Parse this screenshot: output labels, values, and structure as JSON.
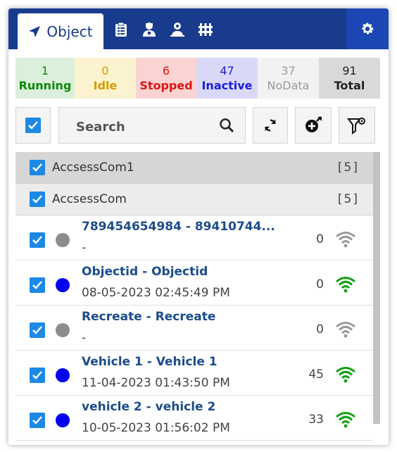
{
  "tabs": {
    "object_label": "Object",
    "icons": [
      "clipboard-list-icon",
      "driver-person-icon",
      "location-person-icon",
      "fence-icon"
    ]
  },
  "status": [
    {
      "count": "1",
      "label": "Running",
      "bg": "#dcefdc",
      "color": "#0a8a0a"
    },
    {
      "count": "0",
      "label": "Idle",
      "bg": "#fbf3cf",
      "color": "#d99a00"
    },
    {
      "count": "6",
      "label": "Stopped",
      "bg": "#fbd3d3",
      "color": "#e01414"
    },
    {
      "count": "47",
      "label": "Inactive",
      "bg": "#d9d9f7",
      "color": "#1c1cd8"
    },
    {
      "count": "37",
      "label": "NoData",
      "bg": "#f2f2f2",
      "color": "#9a9a9a"
    },
    {
      "count": "91",
      "label": "Total",
      "bg": "#d9d9d9",
      "color": "#222222"
    }
  ],
  "search": {
    "placeholder": "Search"
  },
  "groups": [
    {
      "name": "AccsessCom1",
      "count": "[5]"
    },
    {
      "name": "AccsessCom",
      "count": "[5]"
    }
  ],
  "objects": [
    {
      "title": "789454654984 - 89410744...",
      "subtitle": "-",
      "speed": "0",
      "status_color": "#8c8c8c",
      "signal_color": "#9a9a9a"
    },
    {
      "title": "Objectid - Objectid",
      "subtitle": "08-05-2023 02:45:49 PM",
      "speed": "0",
      "status_color": "#0000ee",
      "signal_color": "#14a014"
    },
    {
      "title": "Recreate - Recreate",
      "subtitle": "-",
      "speed": "0",
      "status_color": "#8c8c8c",
      "signal_color": "#9a9a9a"
    },
    {
      "title": "Vehicle 1 - Vehicle 1",
      "subtitle": "11-04-2023 01:43:50 PM",
      "speed": "45",
      "status_color": "#0000ee",
      "signal_color": "#14a014"
    },
    {
      "title": "vehicle 2 - vehicle 2",
      "subtitle": "10-05-2023 01:56:02 PM",
      "speed": "33",
      "status_color": "#0000ee",
      "signal_color": "#14a014"
    }
  ],
  "colors": {
    "header": "#183b8e",
    "accent": "#1e88e5",
    "settings_bg": "#1b46b4"
  }
}
